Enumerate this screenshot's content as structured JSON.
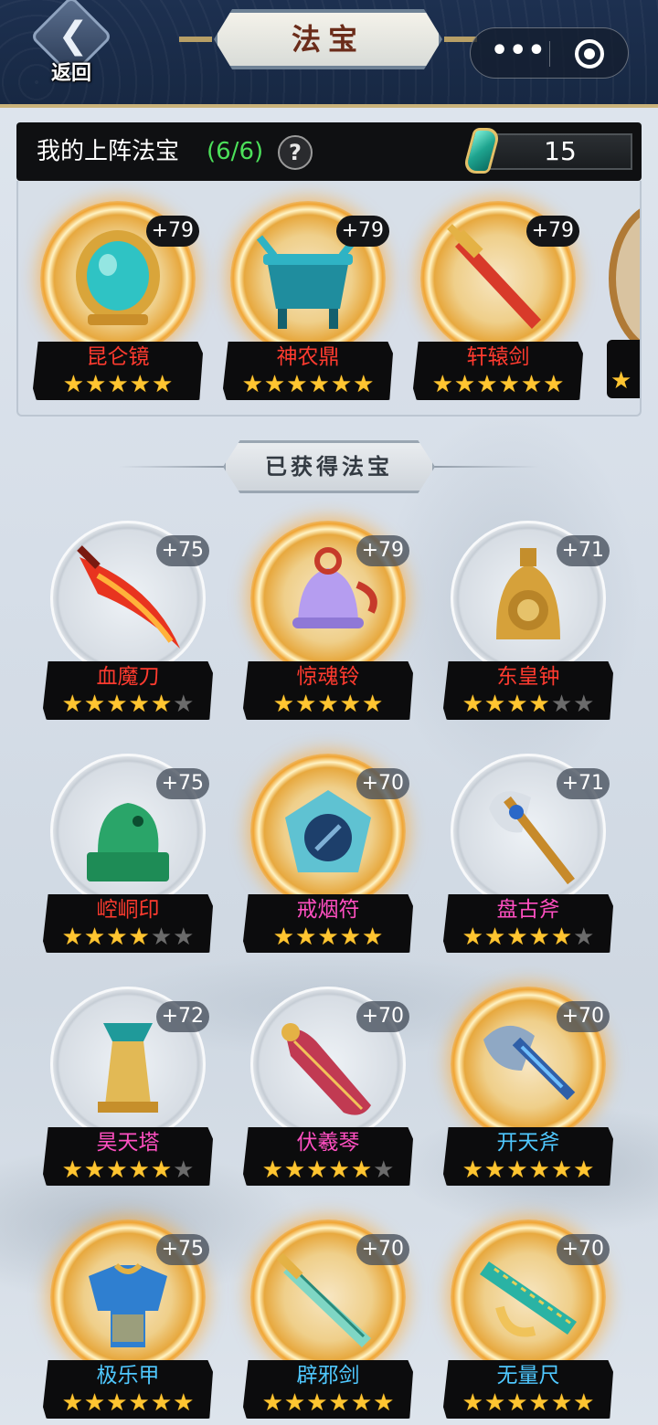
{
  "header": {
    "back_label": "返回",
    "title": "法宝"
  },
  "equipped": {
    "title": "我的上阵法宝",
    "count": "(6/6)",
    "help": "?",
    "gems": "15",
    "items": [
      {
        "name": "昆仑镜",
        "level": "+79",
        "stars": 5,
        "max_stars": 5,
        "icon": "mirror-icon"
      },
      {
        "name": "神农鼎",
        "level": "+79",
        "stars": 6,
        "max_stars": 6,
        "icon": "cauldron-icon"
      },
      {
        "name": "轩辕剑",
        "level": "+79",
        "stars": 6,
        "max_stars": 6,
        "icon": "sword-icon"
      }
    ]
  },
  "owned": {
    "title": "已获得法宝",
    "items": [
      {
        "name": "血魔刀",
        "level": "+75",
        "stars": 5,
        "max_stars": 6,
        "color": "red",
        "gold": false,
        "icon": "blade-icon"
      },
      {
        "name": "惊魂铃",
        "level": "+79",
        "stars": 5,
        "max_stars": 5,
        "color": "red",
        "gold": true,
        "icon": "bell-icon"
      },
      {
        "name": "东皇钟",
        "level": "+71",
        "stars": 4,
        "max_stars": 6,
        "color": "red",
        "gold": false,
        "icon": "golden-bell-icon"
      },
      {
        "name": "崆峒印",
        "level": "+75",
        "stars": 4,
        "max_stars": 6,
        "color": "red",
        "gold": false,
        "icon": "jade-seal-icon"
      },
      {
        "name": "戒烟符",
        "level": "+70",
        "stars": 5,
        "max_stars": 5,
        "color": "pink",
        "gold": true,
        "icon": "talisman-icon"
      },
      {
        "name": "盘古斧",
        "level": "+71",
        "stars": 5,
        "max_stars": 6,
        "color": "pink",
        "gold": false,
        "icon": "axe-icon"
      },
      {
        "name": "昊天塔",
        "level": "+72",
        "stars": 5,
        "max_stars": 6,
        "color": "pink",
        "gold": false,
        "icon": "tower-icon"
      },
      {
        "name": "伏羲琴",
        "level": "+70",
        "stars": 5,
        "max_stars": 6,
        "color": "pink",
        "gold": false,
        "icon": "zither-icon"
      },
      {
        "name": "开天斧",
        "level": "+70",
        "stars": 6,
        "max_stars": 6,
        "color": "blue",
        "gold": true,
        "icon": "battle-axe-icon"
      },
      {
        "name": "极乐甲",
        "level": "+75",
        "stars": 6,
        "max_stars": 6,
        "color": "blue",
        "gold": true,
        "icon": "armor-icon"
      },
      {
        "name": "辟邪剑",
        "level": "+70",
        "stars": 6,
        "max_stars": 6,
        "color": "blue",
        "gold": true,
        "icon": "jade-sword-icon"
      },
      {
        "name": "无量尺",
        "level": "+70",
        "stars": 6,
        "max_stars": 6,
        "color": "blue",
        "gold": true,
        "icon": "ruler-icon"
      }
    ]
  },
  "colors": {
    "header_bg": "#172843",
    "accent_gold": "#c9b27a",
    "count_green": "#4ce05a",
    "star_on": "#ffc531",
    "star_off": "#6b6b6b",
    "name_red": "#ff3b2f",
    "name_pink": "#ff4fc1",
    "name_blue": "#4fc8ff"
  }
}
